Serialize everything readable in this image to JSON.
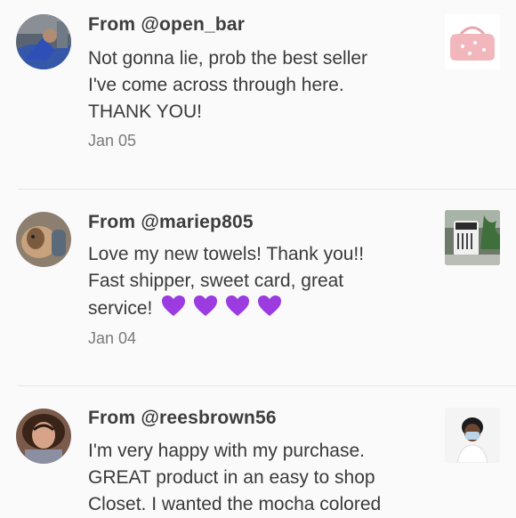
{
  "reviews": [
    {
      "author": "From @open_bar",
      "text_lines": [
        "Not gonna lie, prob the best seller",
        "I've come across through here.",
        "THANK YOU!"
      ],
      "date": "Jan 05",
      "avatar_icon": "avatar-photo",
      "thumb_icon": "pink-duffel-bag-photo"
    },
    {
      "author": "From @mariep805",
      "text_lines": [
        "Love my new towels! Thank you!!",
        "Fast shipper, sweet card, great",
        "service!"
      ],
      "emoji": [
        "💜",
        "💜",
        "💜",
        "💜"
      ],
      "date": "Jan 04",
      "avatar_icon": "avatar-photo",
      "thumb_icon": "towels-product-photo"
    },
    {
      "author": "From @reesbrown56",
      "text_lines": [
        "I'm very happy with my purchase.",
        "GREAT product in an easy to shop",
        "Closet. I wanted the mocha colored"
      ],
      "avatar_icon": "avatar-photo",
      "thumb_icon": "person-wearing-mask-photo"
    }
  ],
  "colors": {
    "background": "#fafafa",
    "text": "#3a3a3a",
    "date": "#7a7a7a",
    "divider": "#e6e6e6",
    "heart": "#9b3be0"
  }
}
